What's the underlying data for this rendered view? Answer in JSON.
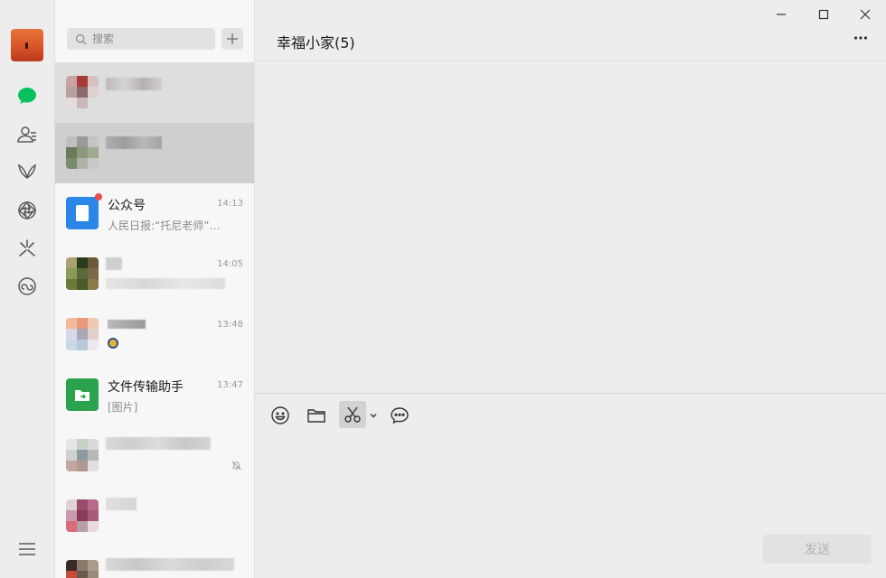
{
  "colors": {
    "accent_green": "#07c160",
    "unread_red": "#f04b4b",
    "official_blue": "#2c86e8",
    "file_green": "#2ba24c"
  },
  "nav": {
    "items": [
      {
        "icon": "chat-icon",
        "active": true
      },
      {
        "icon": "contacts-icon",
        "active": false
      },
      {
        "icon": "favorites-icon",
        "active": false
      },
      {
        "icon": "moments-icon",
        "active": false
      },
      {
        "icon": "channels-icon",
        "active": false
      },
      {
        "icon": "mini-programs-icon",
        "active": false
      }
    ],
    "bottom_icon": "menu-icon"
  },
  "search": {
    "placeholder": "搜索"
  },
  "conversations": [
    {
      "name": "",
      "time": "",
      "message": "",
      "pixelated": true,
      "selected": false,
      "hover": true
    },
    {
      "name": "",
      "time": "",
      "message": "",
      "pixelated": true,
      "selected": true
    },
    {
      "name": "公众号",
      "time": "14:13",
      "message": "人民日报:“托尼老师”…",
      "unread_dot": true
    },
    {
      "name": "",
      "time": "14:05",
      "message": "",
      "pixelated": true
    },
    {
      "name": "",
      "time": "13:48",
      "message": "",
      "pixelated": true
    },
    {
      "name": "文件传输助手",
      "time": "13:47",
      "message": "[图片]"
    },
    {
      "name": "",
      "time": "",
      "message": "",
      "pixelated": true,
      "muted": true
    },
    {
      "name": "",
      "time": "",
      "message": "",
      "pixelated": true
    },
    {
      "name": "",
      "time": "",
      "message": "",
      "pixelated": true
    }
  ],
  "chat": {
    "title": "幸福小家(5)",
    "toolbar": [
      "emoji-icon",
      "folder-icon",
      "screenshot-icon",
      "chat-history-icon"
    ],
    "send_label": "发送"
  }
}
